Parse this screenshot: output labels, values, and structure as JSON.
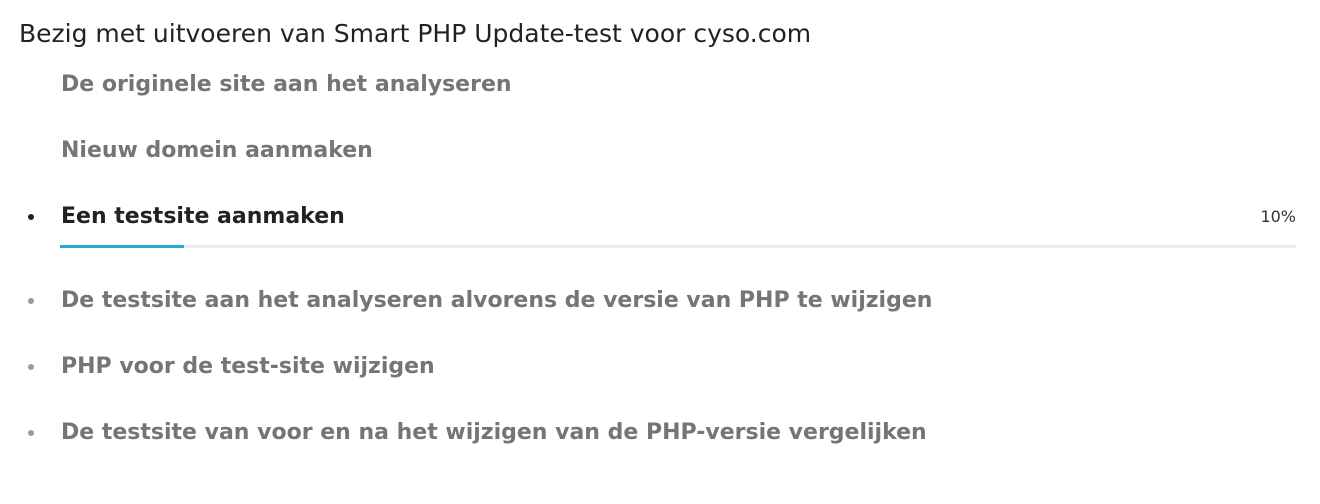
{
  "title": "Bezig met uitvoeren van Smart PHP Update-test voor cyso.com",
  "steps": [
    {
      "label": "De originele site aan het analyseren",
      "status": "done",
      "icon": "check-circle-icon"
    },
    {
      "label": "Nieuw domein aanmaken",
      "status": "done",
      "icon": "check-circle-icon"
    },
    {
      "label": "Een testsite aanmaken",
      "status": "in-progress",
      "icon": "bullet-icon",
      "progress_text": "10%",
      "progress_value": 0.1
    },
    {
      "label": "De testsite aan het analyseren alvorens de versie van PHP te wijzigen",
      "status": "pending",
      "icon": "bullet-icon"
    },
    {
      "label": "PHP voor de test-site wijzigen",
      "status": "pending",
      "icon": "bullet-icon"
    },
    {
      "label": "De testsite van voor en na het wijzigen van de PHP-versie vergelijken",
      "status": "pending",
      "icon": "bullet-icon"
    }
  ],
  "colors": {
    "done_check": "#6fb23a",
    "progress_fill": "#28a8d6",
    "progress_track": "#ececec",
    "active_text": "#222222",
    "muted_text": "#757575"
  }
}
